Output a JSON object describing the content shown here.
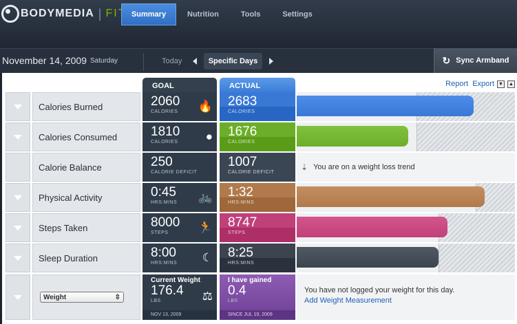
{
  "app": {
    "brand": "BODYMEDIA",
    "product": "FIT"
  },
  "nav": {
    "tabs": [
      "Summary",
      "Nutrition",
      "Tools",
      "Settings"
    ],
    "active": "Summary"
  },
  "datebar": {
    "date": "November 14, 2009",
    "day": "Saturday",
    "today_label": "Today",
    "specific_label": "Specific Days",
    "sync_label": "Sync Armband"
  },
  "columns": {
    "goal": "GOAL",
    "actual": "ACTUAL"
  },
  "links": {
    "report": "Report",
    "export": "Export"
  },
  "colors": {
    "accent": "#3a7cd8",
    "burned": "#3a78d6",
    "consumed": "#6cae2a",
    "activity": "#b07a4d",
    "steps": "#c0407a",
    "sleep": "#3c4450",
    "weight": "#7b4aa3"
  },
  "rows": [
    {
      "label": "Calories Burned",
      "goal": "2060",
      "goal_unit": "CALORIES",
      "actual": "2683",
      "actual_unit": "CALORIES",
      "icon": "flame-icon",
      "fill": 0.81,
      "goal_fill": 0.55
    },
    {
      "label": "Calories Consumed",
      "goal": "1810",
      "goal_unit": "CALORIES",
      "actual": "1676",
      "actual_unit": "CALORIES",
      "icon": "apple-icon",
      "fill": 0.51,
      "goal_fill": 0.55
    },
    {
      "label": "Calorie Balance",
      "goal": "250",
      "goal_unit": "CALORIE DEFICIT",
      "actual": "1007",
      "actual_unit": "CALORIE DEFICIT",
      "trend": "You are on a weight loss trend"
    },
    {
      "label": "Physical Activity",
      "goal": "0:45",
      "goal_unit": "HRS:MINS",
      "actual": "1:32",
      "actual_unit": "HRS:MINS",
      "icon": "bicycle-icon",
      "fill": 0.86,
      "goal_fill": 0.82
    },
    {
      "label": "Steps Taken",
      "goal": "8000",
      "goal_unit": "STEPS",
      "actual": "8747",
      "actual_unit": "STEPS",
      "icon": "runner-icon",
      "fill": 0.69,
      "goal_fill": 0.65
    },
    {
      "label": "Sleep Duration",
      "goal": "8:00",
      "goal_unit": "HRS:MINS",
      "actual": "8:25",
      "actual_unit": "HRS:MINS",
      "icon": "moon-icon",
      "fill": 0.65,
      "goal_fill": 0.65
    }
  ],
  "weight": {
    "select": "Weight",
    "goal_title": "Current Weight",
    "goal_value": "176.4",
    "goal_unit": "LBS",
    "goal_date": "NOV 13, 2009",
    "actual_title": "I have gained",
    "actual_value": "0.4",
    "actual_unit": "LBS",
    "actual_date": "SINCE JUL 19, 2009",
    "message": "You have not logged your weight for this day.",
    "link": "Add Weight Measurement"
  }
}
